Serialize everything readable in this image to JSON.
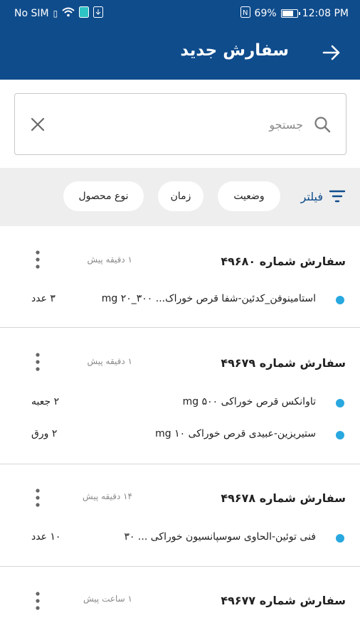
{
  "status_bar": {
    "carrier": "No SIM",
    "battery_percent": "69%",
    "battery_level": 0.69,
    "time": "12:08 PM"
  },
  "app_bar": {
    "title": "سفارش جدید",
    "back_icon": "arrow-right-icon"
  },
  "search": {
    "placeholder": "جستجو",
    "value": "",
    "search_icon": "search-icon",
    "clear_icon": "close-icon"
  },
  "filters": {
    "label": "فیلتر",
    "icon": "filter-icon",
    "chips": [
      "وضعیت",
      "زمان",
      "نوع محصول"
    ]
  },
  "orders": [
    {
      "title": "سفارش شماره ۴۹۶۸۰",
      "time": "۱ دقیقه پیش",
      "items": [
        {
          "name": "استامینوفن_کدئین-شفا قرص خوراک... ۳۰۰_۲۰ mg",
          "qty": "۳ عدد"
        }
      ]
    },
    {
      "title": "سفارش شماره ۴۹۶۷۹",
      "time": "۱ دقیقه پیش",
      "items": [
        {
          "name": "تاوانکس قرص خوراکی ۵۰۰ mg",
          "qty": "۲ جعبه"
        },
        {
          "name": "ستیریزین-عبیدی قرص خوراکی ۱۰ mg",
          "qty": "۲ ورق"
        }
      ]
    },
    {
      "title": "سفارش شماره ۴۹۶۷۸",
      "time": "۱۴ دقیقه پیش",
      "items": [
        {
          "name": "فنی توئین-الحاوی سوسپانسیون خوراکی ... ۳۰",
          "qty": "۱۰ عدد"
        }
      ]
    },
    {
      "title": "سفارش شماره ۴۹۶۷۷",
      "time": "۱ ساعت پیش",
      "items": []
    }
  ],
  "colors": {
    "primary": "#0f4c8c",
    "dot": "#29a8e0",
    "filter_bg": "#eeeeee"
  }
}
